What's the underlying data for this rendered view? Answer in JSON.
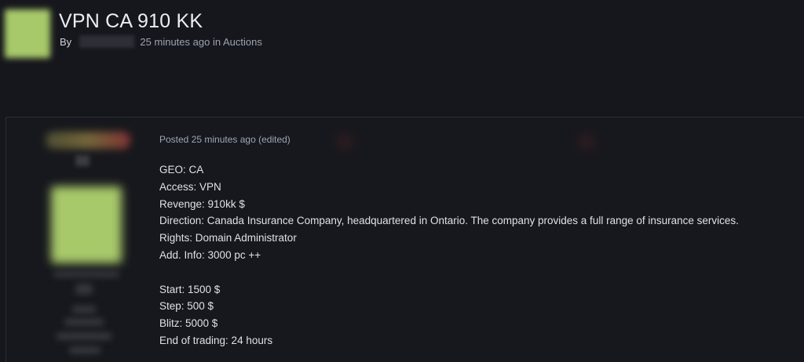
{
  "topic": {
    "title": "VPN CA 910 KK",
    "by_label": "By",
    "time_ago": "25 minutes ago",
    "in_label": "in",
    "forum": "Auctions"
  },
  "post": {
    "posted_text": "Posted 25 minutes ago",
    "edited_text": "(edited)",
    "lines_group1": [
      "GEO: CA",
      "Access: VPN",
      "Revenge: 910kk $",
      "Direction: Canada Insurance Company, headquartered in Ontario. The company provides a full range of insurance services.",
      "Rights: Domain Administrator",
      "Add. Info: 3000 pc ++"
    ],
    "lines_group2": [
      "Start: 1500 $",
      "Step: 500 $",
      "Blitz: 5000 $",
      "End of trading: 24 hours"
    ]
  },
  "colors": {
    "background": "#16171c",
    "avatar_green": "#a8c96a",
    "meta_text": "#9aa3b3"
  }
}
